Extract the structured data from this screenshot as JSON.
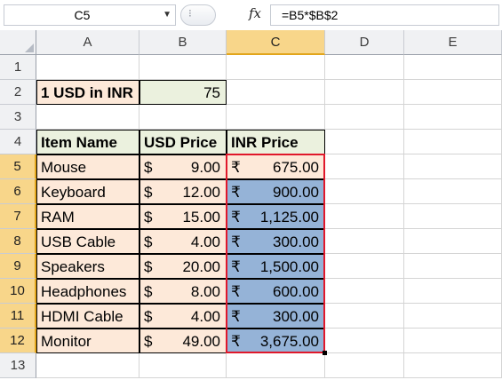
{
  "formula_bar": {
    "name_box": "C5",
    "fx_label": "fx",
    "formula": "=B5*$B$2"
  },
  "columns": [
    "A",
    "B",
    "C",
    "D",
    "E"
  ],
  "rows": [
    "1",
    "2",
    "3",
    "4",
    "5",
    "6",
    "7",
    "8",
    "9",
    "10",
    "11",
    "12",
    "13"
  ],
  "cells": {
    "A2": "1 USD in INR",
    "B2": "75",
    "A4": "Item Name",
    "B4": "USD Price",
    "C4": "INR Price"
  },
  "items": [
    {
      "name": "Mouse",
      "usd": "9.00",
      "inr": "675.00"
    },
    {
      "name": "Keyboard",
      "usd": "12.00",
      "inr": "900.00"
    },
    {
      "name": "RAM",
      "usd": "15.00",
      "inr": "1,125.00"
    },
    {
      "name": "USB Cable",
      "usd": "4.00",
      "inr": "300.00"
    },
    {
      "name": "Speakers",
      "usd": "20.00",
      "inr": "1,500.00"
    },
    {
      "name": "Headphones",
      "usd": "8.00",
      "inr": "600.00"
    },
    {
      "name": "HDMI Cable",
      "usd": "4.00",
      "inr": "300.00"
    },
    {
      "name": "Monitor",
      "usd": "49.00",
      "inr": "3,675.00"
    }
  ],
  "currency": {
    "usd_symbol": "$",
    "inr_symbol": "₹"
  },
  "selected": {
    "column": "C",
    "rows": [
      "5",
      "6",
      "7",
      "8",
      "9",
      "10",
      "11",
      "12"
    ]
  },
  "colors": {
    "selection_border": "#e0182b",
    "inr_fill": "#95b3d7",
    "item_fill": "#fde9d9",
    "usd_header_fill": "#ebf1de"
  }
}
